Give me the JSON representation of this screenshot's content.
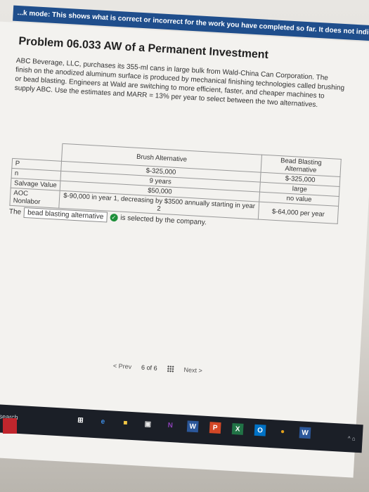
{
  "banner": "...k mode: This shows what is correct or incorrect for the work you have completed so far. It does not indicate complet",
  "problem": {
    "title": "Problem 06.033 AW of a Permanent Investment",
    "description": "ABC Beverage, LLC, purchases its 355-ml cans in large bulk from Wald-China Can Corporation. The finish on the anodized aluminum surface is produced by mechanical finishing technologies called brushing or bead blasting. Engineers at Wald are switching to more efficient, faster, and cheaper machines to supply ABC. Use the estimates and MARR = 13% per year to select between the two alternatives."
  },
  "table": {
    "headers": [
      "",
      "Brush Alternative",
      "Bead Blasting Alternative"
    ],
    "rows": [
      {
        "label": "P",
        "brush": "$-325,000",
        "bead": "$-325,000"
      },
      {
        "label": "n",
        "brush": "9 years",
        "bead": "large"
      },
      {
        "label": "Salvage Value",
        "brush": "$50,000",
        "bead": "no value"
      },
      {
        "label": "AOC Nonlabor",
        "brush": "$-90,000 in year 1, decreasing by $3500 annually starting in year 2",
        "bead": "$-64,000 per year"
      }
    ]
  },
  "answer": {
    "prefix": "The",
    "selected": "bead blasting alternative",
    "suffix": "is selected by the company."
  },
  "pager": {
    "prev": "< Prev",
    "current": "6",
    "of": "of",
    "total": "6",
    "next": "Next >"
  },
  "taskbar": {
    "search_text": "e here to search",
    "icons": [
      "task-view-icon",
      "edge-icon",
      "file-explorer-icon",
      "store-icon",
      "excel-icon",
      "onenote-icon",
      "word-icon",
      "powerpoint-icon",
      "outlook-icon",
      "chrome-icon",
      "winword-icon"
    ],
    "tray": "^ ⌂"
  }
}
